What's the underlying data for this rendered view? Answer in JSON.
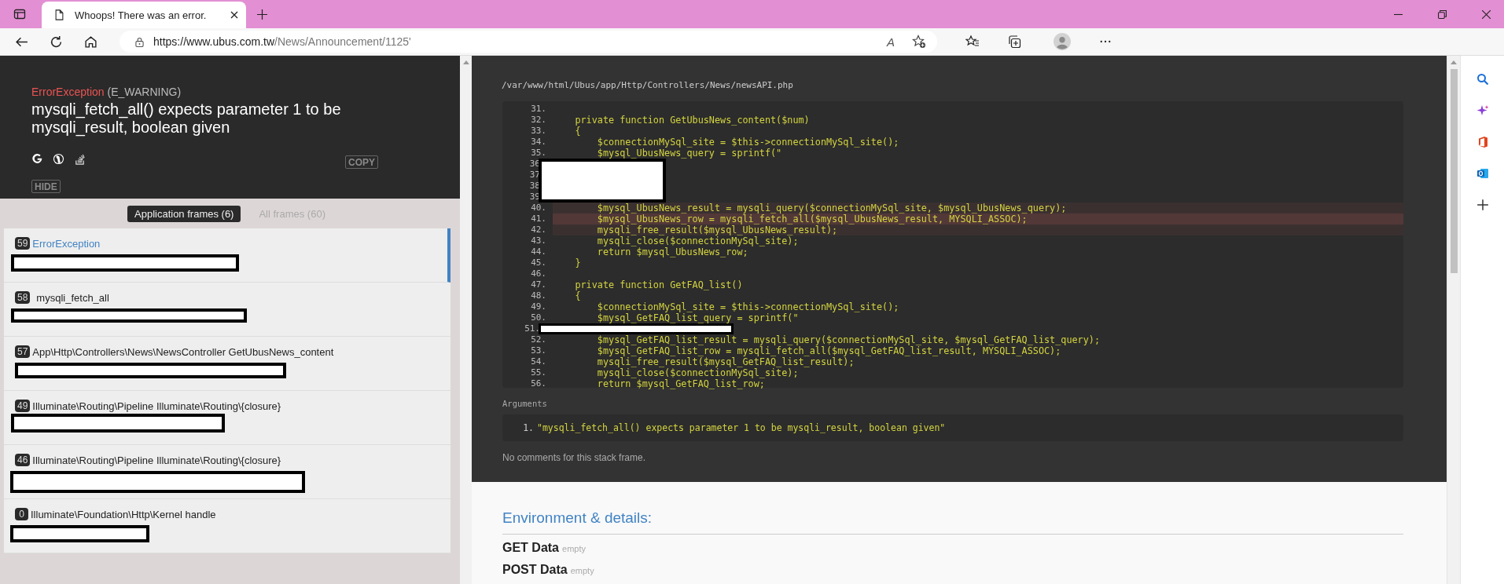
{
  "browser": {
    "tab_title": "Whoops! There was an error.",
    "url_host": "https://www.ubus.com.tw",
    "url_path": "/News/Announcement/1125'",
    "read_aloud_glyph": "A"
  },
  "header": {
    "exception_class": "ErrorException",
    "exception_code": "(E_WARNING)",
    "message": "mysqli_fetch_all() expects parameter 1 to be mysqli_result, boolean given",
    "copy_label": "COPY",
    "hide_label": "HIDE"
  },
  "frame_tabs": [
    {
      "label": "Application frames (6)",
      "selected": true
    },
    {
      "label": "All frames (60)",
      "selected": false
    }
  ],
  "frames": [
    {
      "number": "59",
      "title": "ErrorException",
      "selected": true,
      "path_redacted": true
    },
    {
      "number": "58",
      "title": "mysqli_fetch_all",
      "selected": false,
      "path_redacted": true
    },
    {
      "number": "57",
      "title": "App\\Http\\Controllers\\News\\NewsController GetUbusNews_content",
      "selected": false,
      "path_redacted": true
    },
    {
      "number": "49",
      "title": "Illuminate\\Routing\\Pipeline Illuminate\\Routing\\{closure}",
      "selected": false,
      "path_redacted": true
    },
    {
      "number": "46",
      "title": "Illuminate\\Routing\\Pipeline Illuminate\\Routing\\{closure}",
      "selected": false,
      "path_redacted": true
    },
    {
      "number": "0",
      "title": "Illuminate\\Foundation\\Http\\Kernel handle",
      "selected": false,
      "path_redacted": true
    }
  ],
  "code": {
    "file": "/var/www/html/Ubus/app/Http/Controllers/News/newsAPI.php",
    "lines": [
      {
        "kind": "plain",
        "number": "31."
      },
      {
        "kind": "plain",
        "number": "32.",
        "text": "    private function GetUbusNews_content($num)"
      },
      {
        "kind": "plain",
        "number": "33.",
        "text": "    {"
      },
      {
        "kind": "plain",
        "number": "34.",
        "text": "        $connectionMySql_site = $this->connectionMySql_site();"
      },
      {
        "kind": "plain",
        "number": "35.",
        "text": "        $mysql_UbusNews_query = sprintf(\""
      },
      {
        "kind": "redacted",
        "numbers": [
          "36",
          "37",
          "38",
          "39"
        ]
      },
      {
        "kind": "context",
        "number": "40.",
        "text": "        $mysql_UbusNews_result = mysqli_query($connectionMySql_site, $mysql_UbusNews_query);"
      },
      {
        "kind": "current",
        "number": "41.",
        "text": "        $mysql_UbusNews_row = mysqli_fetch_all($mysql_UbusNews_result, MYSQLI_ASSOC);"
      },
      {
        "kind": "context",
        "number": "42.",
        "text": "        mysqli_free_result($mysql_UbusNews_result);"
      },
      {
        "kind": "plain",
        "number": "43.",
        "text": "        mysqli_close($connectionMySql_site);"
      },
      {
        "kind": "plain",
        "number": "44.",
        "text": "        return $mysql_UbusNews_row;"
      },
      {
        "kind": "plain",
        "number": "45.",
        "text": "    }"
      },
      {
        "kind": "plain",
        "number": "46."
      },
      {
        "kind": "plain",
        "number": "47.",
        "text": "    private function GetFAQ_list()"
      },
      {
        "kind": "plain",
        "number": "48.",
        "text": "    {"
      },
      {
        "kind": "plain",
        "number": "49.",
        "text": "        $connectionMySql_site = $this->connectionMySql_site();"
      },
      {
        "kind": "plain",
        "number": "50.",
        "text": "        $mysql_GetFAQ_list_query = sprintf(\""
      },
      {
        "kind": "redacted",
        "numbers": [
          "51."
        ]
      },
      {
        "kind": "plain",
        "number": "52.",
        "text": "        $mysql_GetFAQ_list_result = mysqli_query($connectionMySql_site, $mysql_GetFAQ_list_query);"
      },
      {
        "kind": "plain",
        "number": "53.",
        "text": "        $mysql_GetFAQ_list_row = mysqli_fetch_all($mysql_GetFAQ_list_result, MYSQLI_ASSOC);"
      },
      {
        "kind": "plain",
        "number": "54.",
        "text": "        mysqli_free_result($mysql_GetFAQ_list_result);"
      },
      {
        "kind": "plain",
        "number": "55.",
        "text": "        mysqli_close($connectionMySql_site);"
      },
      {
        "kind": "plain",
        "number": "56.",
        "text": "        return $mysql_GetFAQ_list_row;"
      }
    ]
  },
  "arguments": {
    "label": "Arguments",
    "items": [
      {
        "number": "1.",
        "value": "\"mysqli_fetch_all() expects parameter 1 to be mysqli_result, boolean given\""
      }
    ]
  },
  "comments": "No comments for this stack frame.",
  "environment": {
    "heading": "Environment & details:",
    "sections": [
      {
        "label": "GET Data",
        "value": "empty"
      },
      {
        "label": "POST Data",
        "value": "empty"
      }
    ]
  }
}
